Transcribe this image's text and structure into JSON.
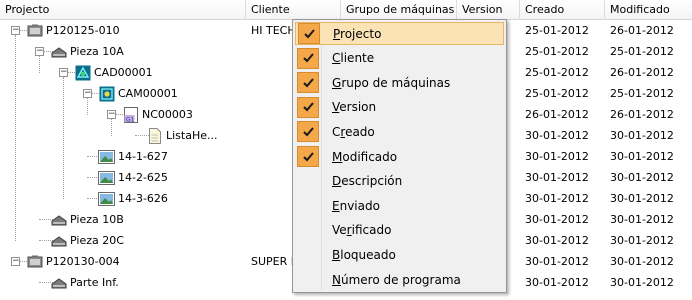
{
  "columns": [
    "Projecto",
    "Cliente",
    "Grupo de máquinas",
    "Version",
    "Creado",
    "Modificado"
  ],
  "rows": [
    {
      "name": "P120125-010",
      "icon": "project-icon",
      "expander": "minus",
      "cliente": "HI TECH",
      "creado": "25-01-2012",
      "modificado": "26-01-2012"
    },
    {
      "name": "Pieza 10A",
      "icon": "part-icon",
      "expander": "minus",
      "cliente": "",
      "creado": "25-01-2012",
      "modificado": "25-01-2012"
    },
    {
      "name": "CAD00001",
      "icon": "cad-icon",
      "expander": "minus",
      "cliente": "",
      "creado": "25-01-2012",
      "modificado": "26-01-2012"
    },
    {
      "name": "CAM00001",
      "icon": "cam-icon",
      "expander": "minus",
      "cliente": "",
      "creado": "25-01-2012",
      "modificado": "25-01-2012"
    },
    {
      "name": "NC00003",
      "icon": "nc-icon",
      "expander": "minus",
      "cliente": "",
      "creado": "26-01-2012",
      "modificado": "26-01-2012"
    },
    {
      "name": "ListaHe...",
      "icon": "document-icon",
      "expander": "",
      "cliente": "",
      "creado": "30-01-2012",
      "modificado": "30-01-2012"
    },
    {
      "name": "14-1-627",
      "icon": "image-icon",
      "expander": "",
      "cliente": "",
      "creado": "30-01-2012",
      "modificado": "30-01-2012"
    },
    {
      "name": "14-2-625",
      "icon": "image-icon",
      "expander": "",
      "cliente": "",
      "creado": "30-01-2012",
      "modificado": "30-01-2012"
    },
    {
      "name": "14-3-626",
      "icon": "image-icon",
      "expander": "",
      "cliente": "",
      "creado": "30-01-2012",
      "modificado": "30-01-2012"
    },
    {
      "name": "Pieza 10B",
      "icon": "part-icon",
      "expander": "",
      "cliente": "",
      "creado": "30-01-2012",
      "modificado": "30-01-2012"
    },
    {
      "name": "Pieza 20C",
      "icon": "part-icon",
      "expander": "",
      "cliente": "",
      "creado": "30-01-2012",
      "modificado": "30-01-2012"
    },
    {
      "name": "P120130-004",
      "icon": "project-icon",
      "expander": "minus",
      "cliente": "SUPER I",
      "creado": "30-01-2012",
      "modificado": "30-01-2012"
    },
    {
      "name": "Parte Inf.",
      "icon": "part-icon",
      "expander": "",
      "cliente": "",
      "creado": "30-01-2012",
      "modificado": "30-01-2012"
    }
  ],
  "menu": {
    "items": [
      {
        "label": "Projecto",
        "checked": true,
        "highlighted": true
      },
      {
        "label": "Cliente",
        "checked": true
      },
      {
        "label": "Grupo de máquinas",
        "checked": true
      },
      {
        "label": "Version",
        "checked": true
      },
      {
        "label": "Creado",
        "checked": true
      },
      {
        "label": "Modificado",
        "checked": true
      },
      {
        "label": "Descripción",
        "checked": false
      },
      {
        "label": "Enviado",
        "checked": false
      },
      {
        "label": "Verificado",
        "checked": false
      },
      {
        "label": "Bloqueado",
        "checked": false
      },
      {
        "label": "Número de programa",
        "checked": false
      }
    ]
  },
  "colors": {
    "check_bg": "#f5a84a",
    "highlight_bg": "#fce3b6",
    "menu_bg": "#f0f0f0"
  }
}
